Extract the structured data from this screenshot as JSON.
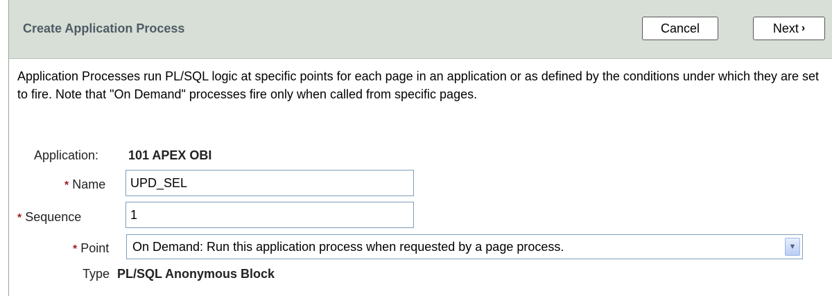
{
  "header": {
    "title": "Create Application Process",
    "cancel_label": "Cancel",
    "next_label": "Next",
    "next_chevron": "›"
  },
  "description": "Application Processes run PL/SQL logic at specific points for each page in an application or as defined by the conditions under which they are set to fire. Note that \"On Demand\" processes fire only when called from specific pages.",
  "form": {
    "application_label": "Application:",
    "application_value": "101 APEX OBI",
    "required_marker": "*",
    "name_label": "Name",
    "name_value": "UPD_SEL",
    "sequence_label": "Sequence",
    "sequence_value": "1",
    "point_label": "Point",
    "point_value": "On Demand: Run this application process when requested by a page process.",
    "type_label": "Type",
    "type_value": "PL/SQL Anonymous Block"
  },
  "colors": {
    "header_bg": "#d7dfd6",
    "title_color": "#4f5b66",
    "required_color": "#a21f1f",
    "input_border": "#7f9db9"
  }
}
